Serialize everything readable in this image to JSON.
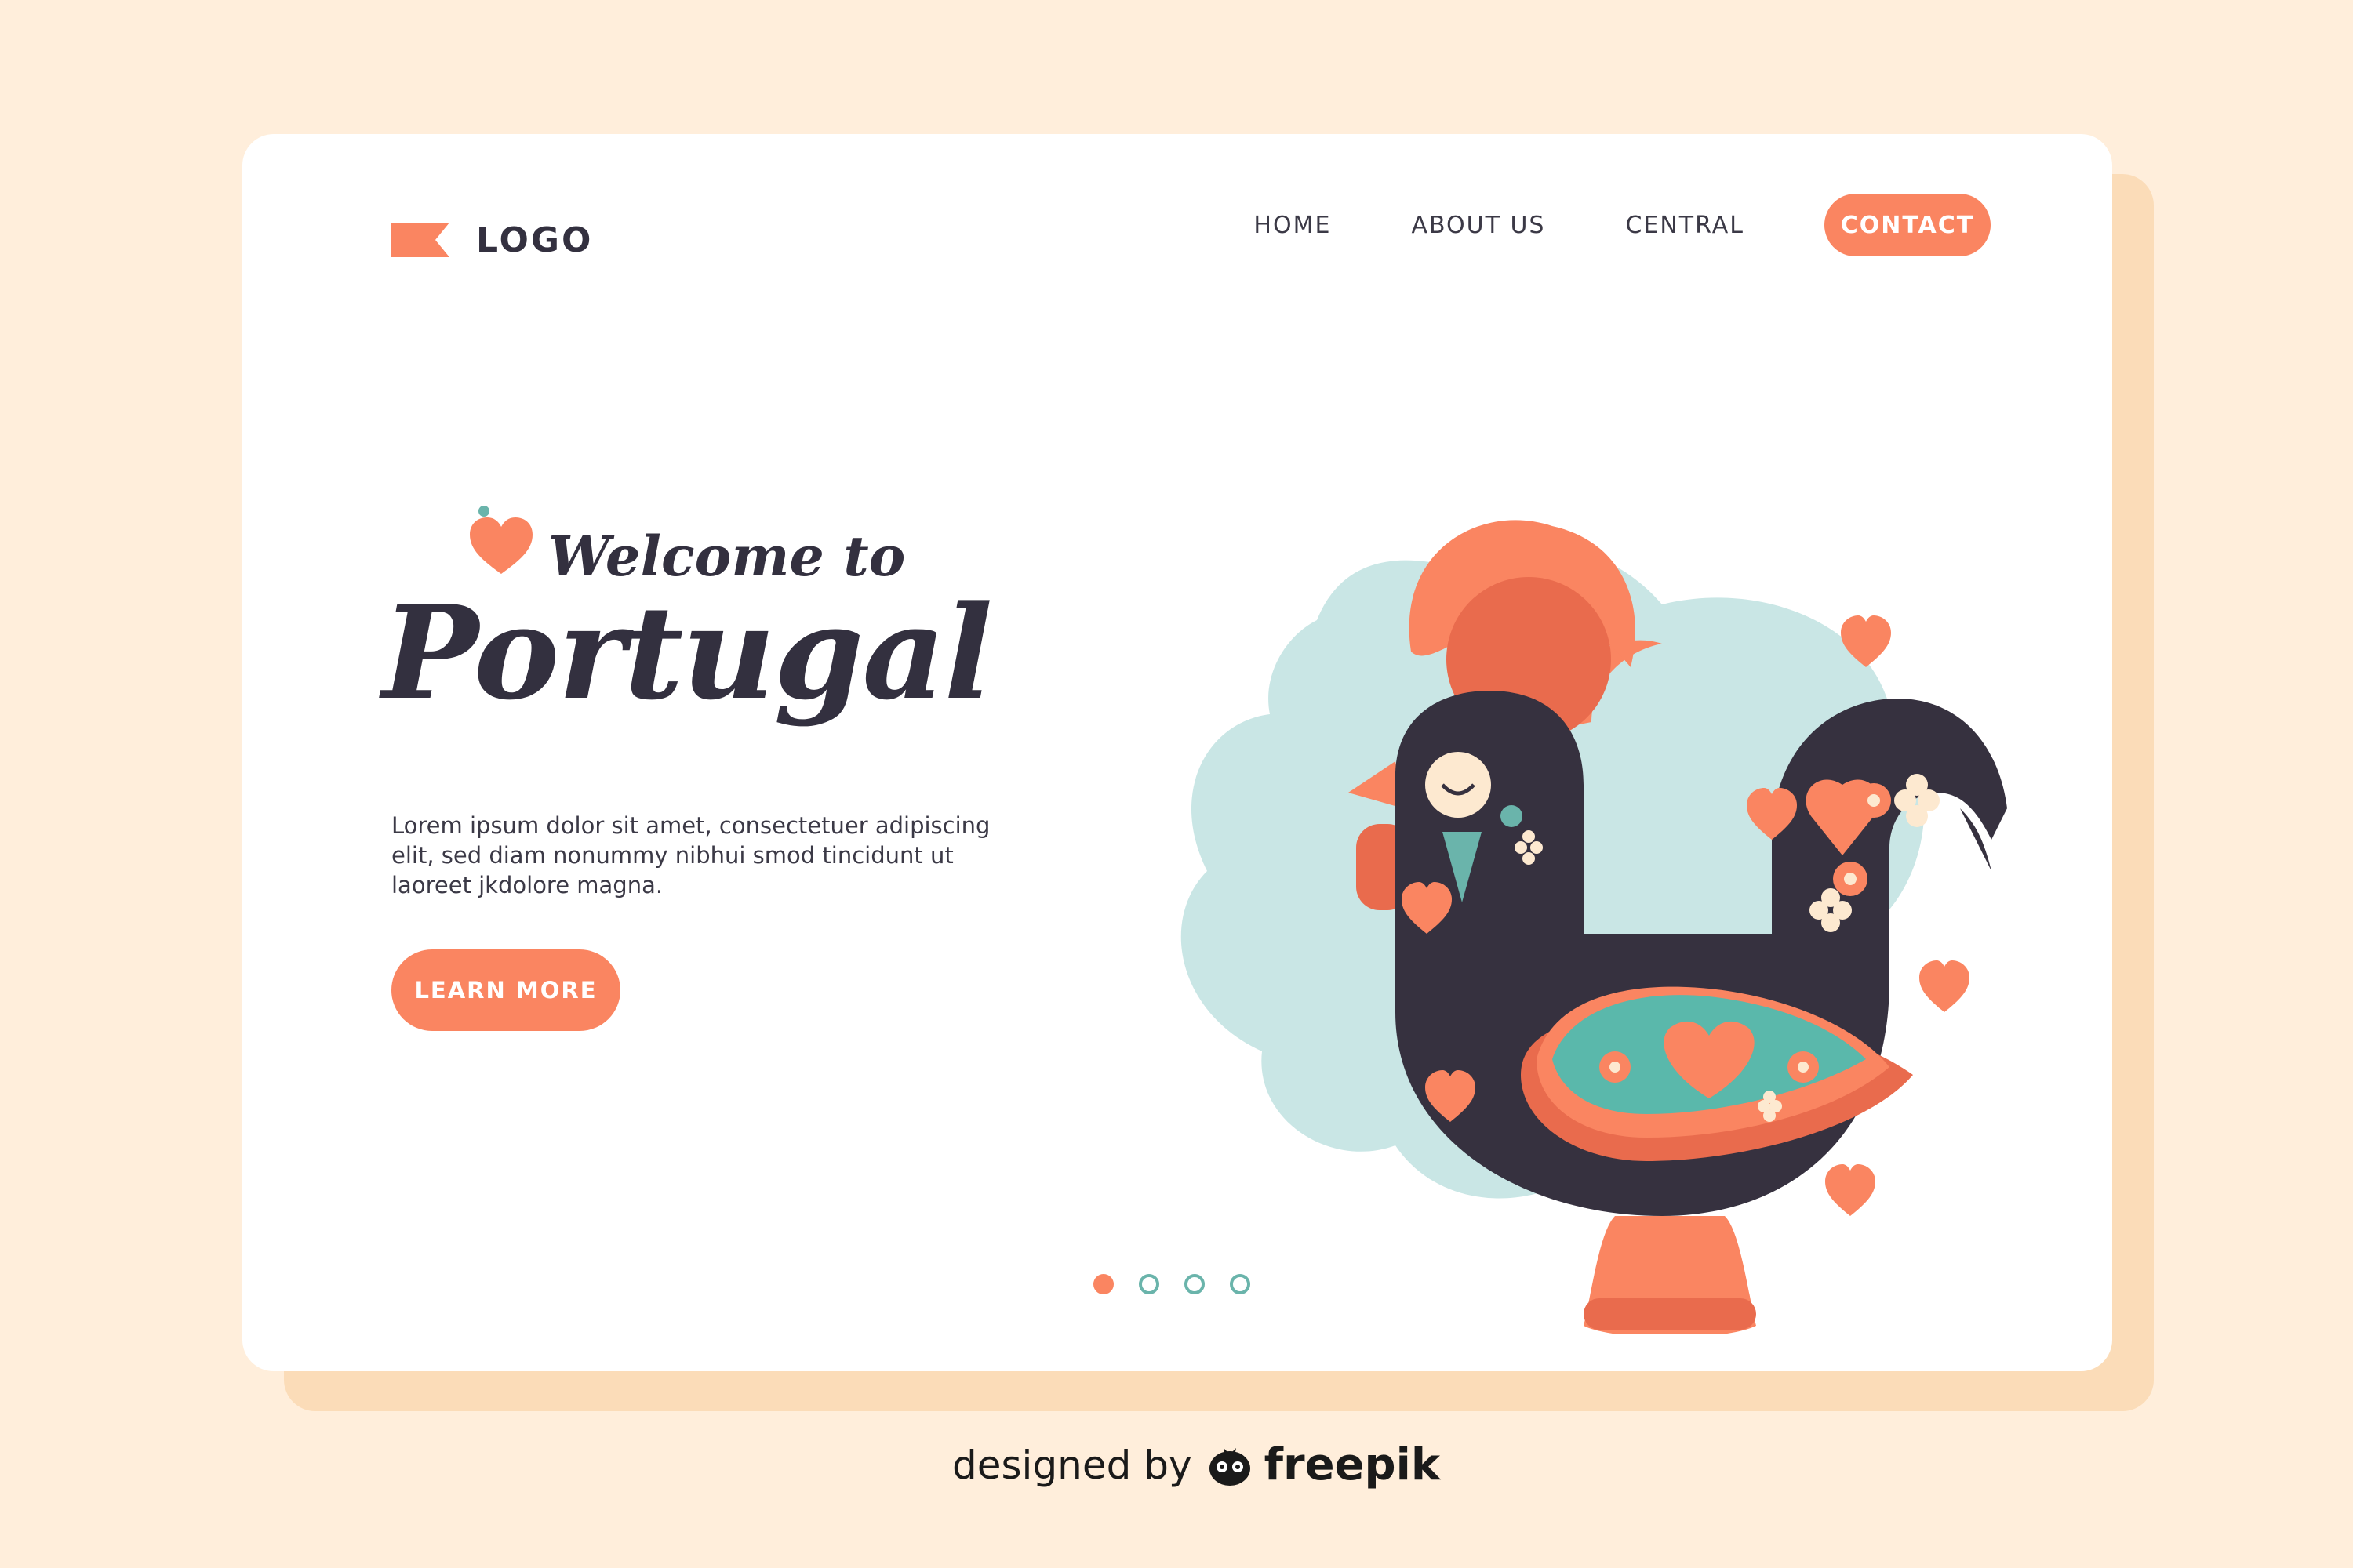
{
  "header": {
    "logo_text": "LOGO",
    "logo_icon": "flag-icon",
    "nav": [
      "HOME",
      "ABOUT US",
      "CENTRAL"
    ],
    "contact_label": "CONTACT"
  },
  "hero": {
    "welcome": "Welcome to",
    "title": "Portugal",
    "body": "Lorem ipsum dolor sit amet, consectetuer adipiscing elit, sed diam nonummy nibhui smod tincidunt ut laoreet jkdolore magna.",
    "button_label": "LEARN MORE",
    "illustration": "barcelos-rooster-illustration"
  },
  "carousel": {
    "total": 4,
    "active_index": 0
  },
  "credit": {
    "prefix": "designed by",
    "brand": "freepik"
  },
  "colors": {
    "background": "#ffeedb",
    "card_shadow": "#fbdcb8",
    "accent": "#fa8561",
    "dark": "#33303f",
    "mint": "#c9e6e5",
    "teal": "#6ab4ab"
  }
}
